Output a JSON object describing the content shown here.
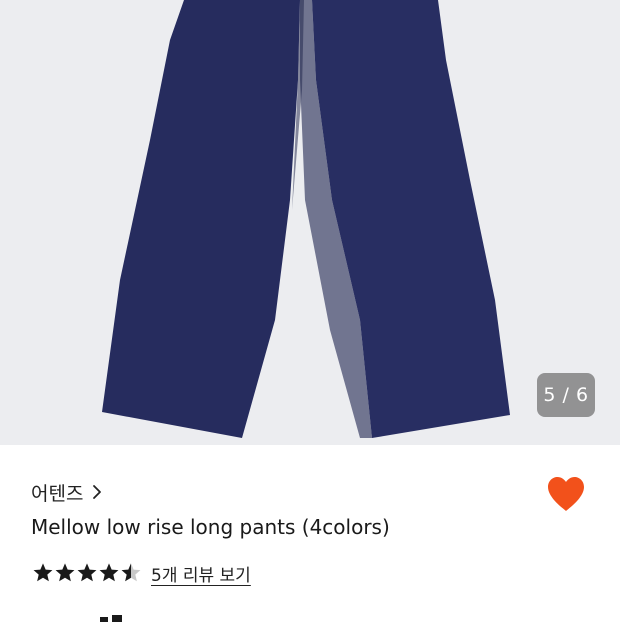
{
  "gallery": {
    "counter": "5 / 6",
    "background_color": "#ecedf0",
    "product_color": "#262c5e",
    "image_subject": "navy-wide-leg-pants"
  },
  "product": {
    "brand": "어텐즈",
    "title": "Mellow low rise long pants (4colors)",
    "rating": 4.5,
    "rating_max": 5,
    "review_link": "5개 리뷰 보기",
    "wishlisted": true,
    "heart_color": "#f2511b"
  },
  "icons": {
    "brand_chevron": "chevron-right-icon",
    "wishlist": "heart-icon",
    "star": "star-icon"
  }
}
